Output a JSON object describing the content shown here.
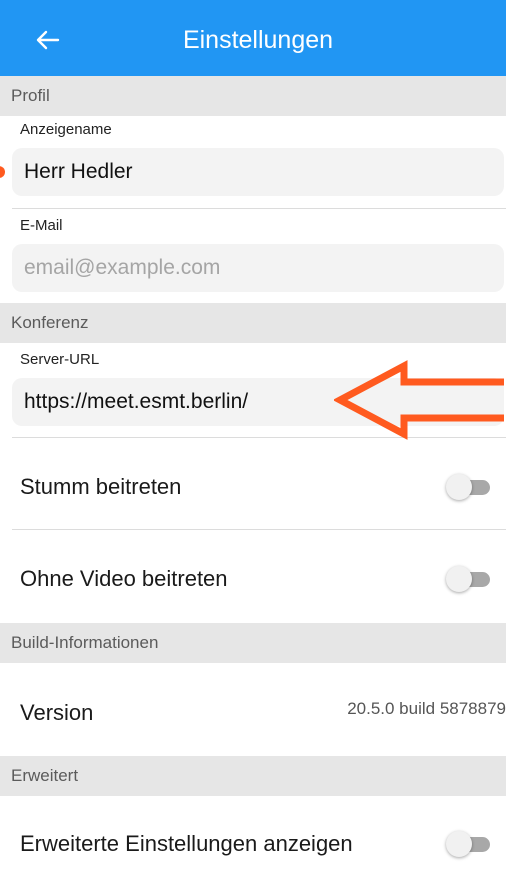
{
  "appbar": {
    "title": "Einstellungen",
    "back_icon": "arrow-left-icon"
  },
  "sections": {
    "profile": "Profil",
    "conference": "Konferenz",
    "build": "Build-Informationen",
    "advanced": "Erweitert"
  },
  "profile": {
    "display_name_label": "Anzeigename",
    "display_name_value": "Herr Hedler",
    "email_label": "E-Mail",
    "email_value": "",
    "email_placeholder": "email@example.com"
  },
  "conference": {
    "server_url_label": "Server-URL",
    "server_url_value": "https://meet.esmt.berlin/",
    "join_muted_label": "Stumm beitreten",
    "join_muted_on": false,
    "join_no_video_label": "Ohne Video beitreten",
    "join_no_video_on": false
  },
  "build": {
    "version_label": "Version",
    "version_value": "20.5.0 build 5878879"
  },
  "advanced": {
    "show_advanced_label": "Erweiterte Einstellungen anzeigen",
    "show_advanced_on": false
  },
  "colors": {
    "appbar": "#2196f3",
    "annotation": "#ff5a1f",
    "section_bg": "#e6e6e6",
    "input_bg": "#f3f3f3"
  }
}
